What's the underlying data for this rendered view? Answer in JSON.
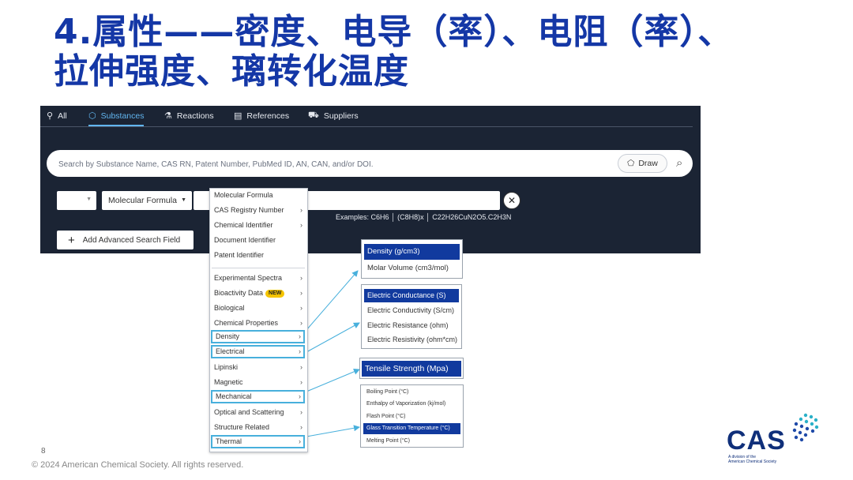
{
  "slide": {
    "title_line1": "4.属性——密度、电导（率）、电阻（率）、",
    "title_line2": "拉伸强度、璃转化温度",
    "page_number": "8",
    "footer": "© 2024 American Chemical Society. All rights reserved."
  },
  "logo": {
    "text": "CAS",
    "sub_line1": "A division of the",
    "sub_line2": "American Chemical Society"
  },
  "tabs": [
    {
      "label": "All",
      "icon": "⚲"
    },
    {
      "label": "Substances",
      "icon": "⬡"
    },
    {
      "label": "Reactions",
      "icon": "⚗"
    },
    {
      "label": "References",
      "icon": "▤"
    },
    {
      "label": "Suppliers",
      "icon": "⛟"
    }
  ],
  "search": {
    "placeholder": "Search by Substance Name, CAS RN, Patent Number, PubMed ID, AN, CAN, and/or DOI.",
    "draw_label": "Draw",
    "draw_icon": "⬠",
    "search_icon": "⌕"
  },
  "filter": {
    "field_select": "Molecular Formula",
    "examples": "Examples: C6H6  │ (C8H8)x  │ C22H26CuN2O5.C2H3N",
    "add_field_label": "Add Advanced Search Field",
    "clear_icon": "✕"
  },
  "dropdown": {
    "items": [
      {
        "label": "Molecular Formula",
        "chev": ""
      },
      {
        "label": "CAS Registry Number",
        "chev": "›"
      },
      {
        "label": "Chemical Identifier",
        "chev": "›"
      },
      {
        "label": "Document Identifier",
        "chev": ""
      },
      {
        "label": "Patent Identifier",
        "chev": ""
      },
      {
        "label": "Experimental Spectra",
        "chev": "›"
      },
      {
        "label": "Bioactivity Data",
        "chev": "›",
        "badge": "NEW"
      },
      {
        "label": "Biological",
        "chev": "›"
      },
      {
        "label": "Chemical Properties",
        "chev": "›"
      },
      {
        "label": "Density",
        "chev": "›"
      },
      {
        "label": "Electrical",
        "chev": "›"
      },
      {
        "label": "Lipinski",
        "chev": "›"
      },
      {
        "label": "Magnetic",
        "chev": "›"
      },
      {
        "label": "Mechanical",
        "chev": "›"
      },
      {
        "label": "Optical and Scattering",
        "chev": "›"
      },
      {
        "label": "Structure Related",
        "chev": "›"
      },
      {
        "label": "Thermal",
        "chev": "›"
      }
    ]
  },
  "density_panel": [
    "Density (g/cm3)",
    "Molar Volume (cm3/mol)"
  ],
  "electrical_panel": [
    "Electric Conductance (S)",
    "Electric Conductivity (S/cm)",
    "Electric Resistance (ohm)",
    "Electric Resistivity (ohm*cm)"
  ],
  "mechanical_panel": [
    "Tensile Strength (Mpa)"
  ],
  "thermal_panel": [
    "Boiling Point (°C)",
    "Enthalpy of Vaporization (kj/mol)",
    "Flash Point (°C)",
    "Glass Transition Temperature (°C)",
    "Melting Point (°C)"
  ],
  "colors": {
    "title": "#1437a6",
    "ui_bg": "#1b2434",
    "active_tab": "#62b6f0",
    "highlight_border": "#48b0dc",
    "selected_item": "#113a9e"
  }
}
